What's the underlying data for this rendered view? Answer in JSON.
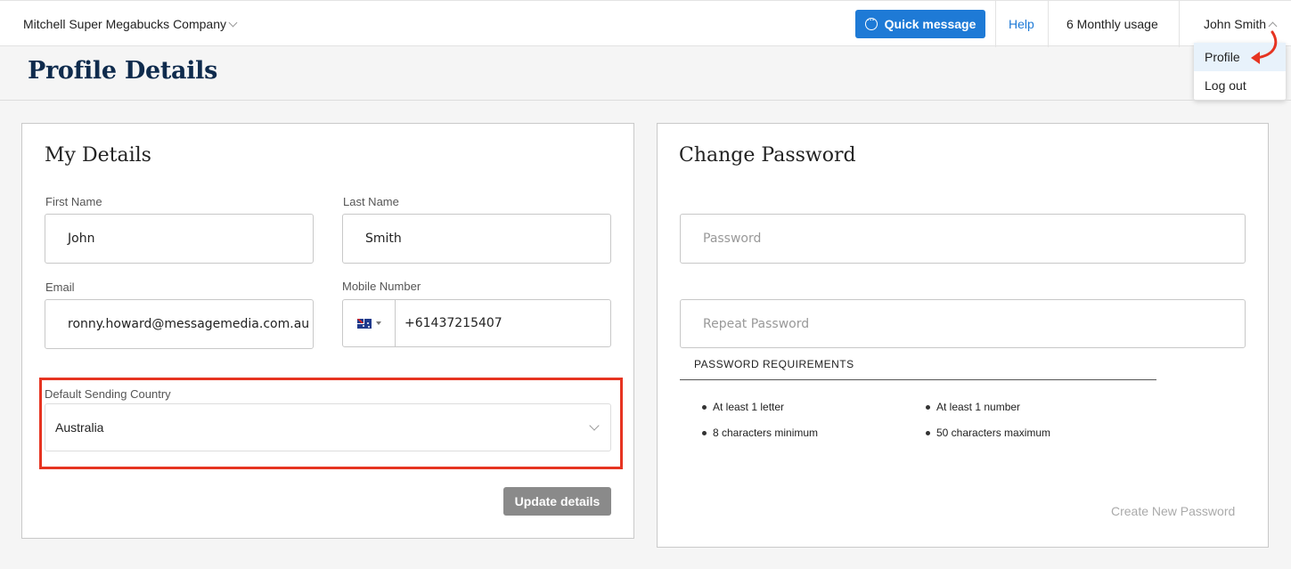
{
  "topbar": {
    "company": "Mitchell Super Megabucks Company",
    "quick_message": "Quick message",
    "help": "Help",
    "usage": "6 Monthly usage",
    "user": "John Smith"
  },
  "user_menu": {
    "items": [
      "Profile",
      "Log out"
    ],
    "active": "Profile"
  },
  "page": {
    "title": "Profile Details"
  },
  "my_details": {
    "title": "My Details",
    "first_name_label": "First Name",
    "first_name": "John",
    "last_name_label": "Last Name",
    "last_name": "Smith",
    "email_label": "Email",
    "email": "ronny.howard@messagemedia.com.au",
    "mobile_label": "Mobile Number",
    "mobile": "+61437215407",
    "country_label": "Default Sending Country",
    "country": "Australia",
    "update_button": "Update details"
  },
  "change_password": {
    "title": "Change Password",
    "password_placeholder": "Password",
    "repeat_placeholder": "Repeat Password",
    "requirements_title": "PASSWORD REQUIREMENTS",
    "requirements": [
      "At least 1 letter",
      "At least 1 number",
      "8 characters minimum",
      "50 characters maximum"
    ],
    "create_button": "Create New Password"
  },
  "colors": {
    "accent": "#1e7ad6",
    "title": "#0f2b4d",
    "highlight": "#e63421",
    "button_disabled": "#8a8a8a"
  }
}
